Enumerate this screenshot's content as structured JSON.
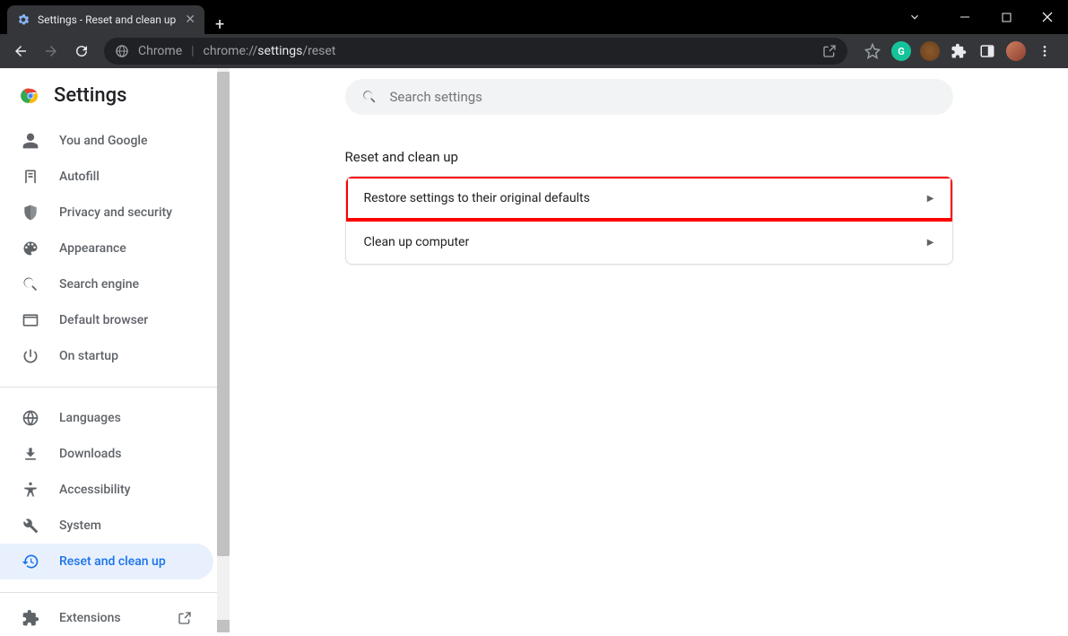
{
  "tab": {
    "title": "Settings - Reset and clean up"
  },
  "omnibox": {
    "chrome_label": "Chrome",
    "url_prefix": "chrome://",
    "url_bold": "settings",
    "url_suffix": "/reset"
  },
  "brand": {
    "title": "Settings"
  },
  "search": {
    "placeholder": "Search settings"
  },
  "sidebar": {
    "group1": [
      {
        "label": "You and Google",
        "icon": "person"
      },
      {
        "label": "Autofill",
        "icon": "autofill"
      },
      {
        "label": "Privacy and security",
        "icon": "shield"
      },
      {
        "label": "Appearance",
        "icon": "palette"
      },
      {
        "label": "Search engine",
        "icon": "search"
      },
      {
        "label": "Default browser",
        "icon": "browser"
      },
      {
        "label": "On startup",
        "icon": "power"
      }
    ],
    "group2": [
      {
        "label": "Languages",
        "icon": "globe"
      },
      {
        "label": "Downloads",
        "icon": "download"
      },
      {
        "label": "Accessibility",
        "icon": "accessibility"
      },
      {
        "label": "System",
        "icon": "wrench"
      },
      {
        "label": "Reset and clean up",
        "icon": "restore",
        "active": true
      }
    ],
    "extensions": {
      "label": "Extensions"
    }
  },
  "section": {
    "title": "Reset and clean up",
    "rows": [
      {
        "label": "Restore settings to their original defaults",
        "highlight": true
      },
      {
        "label": "Clean up computer",
        "highlight": false
      }
    ]
  }
}
